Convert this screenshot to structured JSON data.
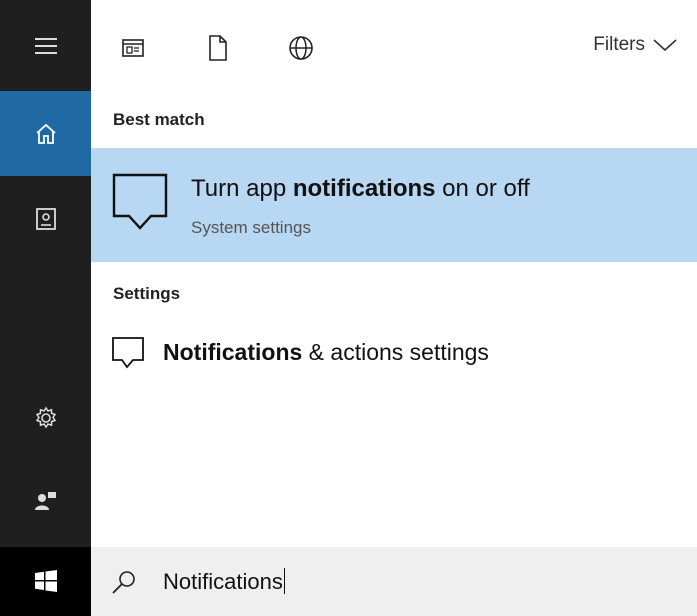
{
  "sidebar": {
    "items": [
      {
        "icon": "hamburger-menu-icon"
      },
      {
        "icon": "home-icon"
      },
      {
        "icon": "notebook-icon"
      },
      {
        "icon": "settings-gear-icon"
      },
      {
        "icon": "feedback-icon"
      },
      {
        "icon": "windows-start-icon"
      }
    ],
    "active_color": "#1f6aa5"
  },
  "toolbar": {
    "filters_label": "Filters",
    "scope_icons": [
      "apps-icon",
      "documents-icon",
      "web-icon"
    ]
  },
  "results": {
    "best_match_heading": "Best match",
    "best_match": {
      "title_before": "Turn app ",
      "title_bold": "notifications",
      "title_after": " on or off",
      "subtitle": "System settings",
      "highlight_color": "#b7d7f2"
    },
    "settings_heading": "Settings",
    "settings_items": [
      {
        "bold": "Notifications",
        "rest": " & actions settings"
      }
    ]
  },
  "search": {
    "query": "Notifications"
  }
}
